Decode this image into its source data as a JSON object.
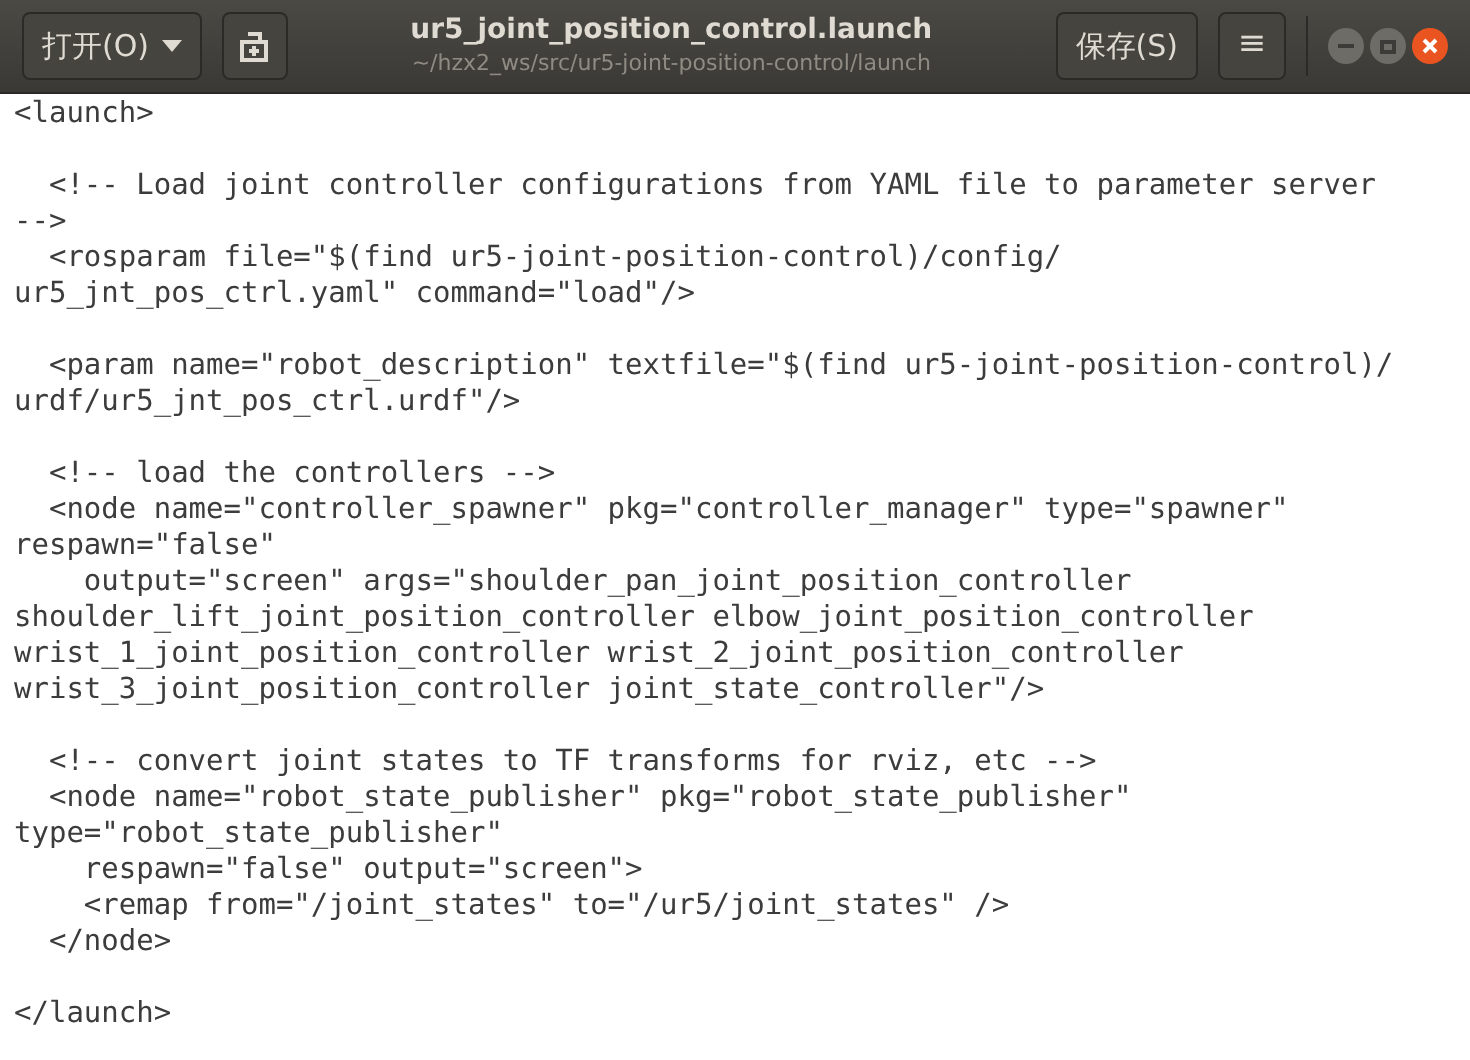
{
  "header": {
    "open_button": "打开(O)",
    "title": "ur5_joint_position_control.launch",
    "subtitle": "~/hzx2_ws/src/ur5-joint-position-control/launch",
    "save_button": "保存(S)",
    "menu_button": "≡"
  },
  "editor": {
    "lines": [
      {
        "kind": "code",
        "text": "<launch>"
      },
      {
        "kind": "blank"
      },
      {
        "kind": "code",
        "text": "  <!-- Load joint controller configurations from YAML file to parameter server"
      },
      {
        "kind": "code",
        "text": "-->"
      },
      {
        "kind": "code",
        "text": "  <rosparam file=\"$(find ur5-joint-position-control)/config/"
      },
      {
        "kind": "code",
        "text": "ur5_jnt_pos_ctrl.yaml\" command=\"load\"/>"
      },
      {
        "kind": "blank"
      },
      {
        "kind": "code",
        "text": "  <param name=\"robot_description\" textfile=\"$(find ur5-joint-position-control)/"
      },
      {
        "kind": "code",
        "text": "urdf/ur5_jnt_pos_ctrl.urdf\"/>"
      },
      {
        "kind": "blank"
      },
      {
        "kind": "code",
        "text": "  <!-- load the controllers -->"
      },
      {
        "kind": "code",
        "text": "  <node name=\"controller_spawner\" pkg=\"controller_manager\" type=\"spawner\""
      },
      {
        "kind": "code",
        "text": "respawn=\"false\""
      },
      {
        "kind": "code",
        "text": "    output=\"screen\" args=\"shoulder_pan_joint_position_controller"
      },
      {
        "kind": "code",
        "text": "shoulder_lift_joint_position_controller elbow_joint_position_controller"
      },
      {
        "kind": "code",
        "text": "wrist_1_joint_position_controller wrist_2_joint_position_controller"
      },
      {
        "kind": "code",
        "text": "wrist_3_joint_position_controller joint_state_controller\"/>"
      },
      {
        "kind": "blank"
      },
      {
        "kind": "code",
        "text": "  <!-- convert joint states to TF transforms for rviz, etc -->"
      },
      {
        "kind": "code",
        "text": "  <node name=\"robot_state_publisher\" pkg=\"robot_state_publisher\""
      },
      {
        "kind": "code",
        "text": "type=\"robot_state_publisher\""
      },
      {
        "kind": "code",
        "text": "    respawn=\"false\" output=\"screen\">"
      },
      {
        "kind": "code",
        "text": "    <remap from=\"/joint_states\" to=\"/ur5/joint_states\" />"
      },
      {
        "kind": "code",
        "text": "  </node>"
      },
      {
        "kind": "blank"
      },
      {
        "kind": "code",
        "text": "</launch>"
      }
    ]
  }
}
